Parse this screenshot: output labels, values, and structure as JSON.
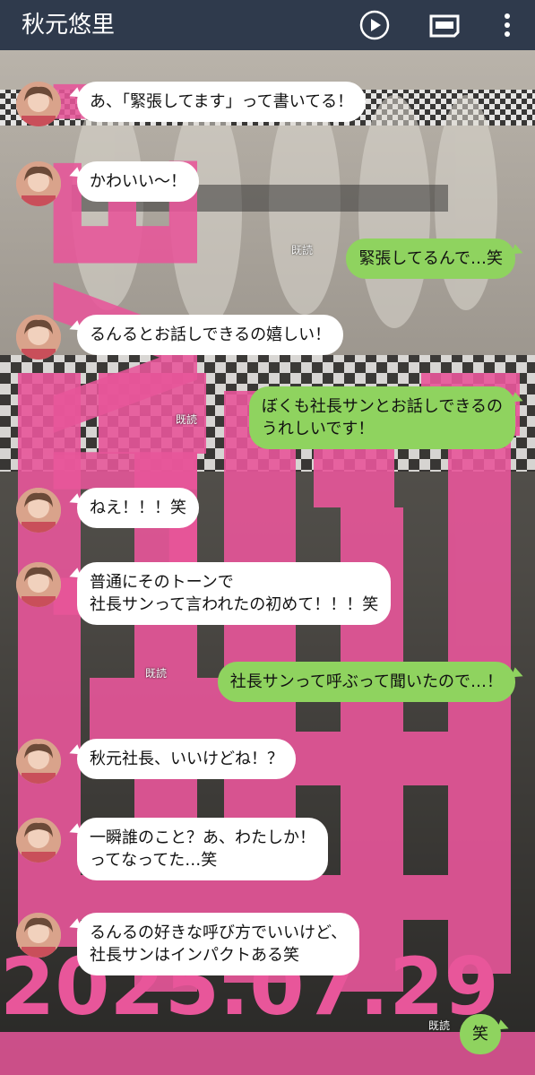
{
  "header": {
    "title": "秋元悠里",
    "play_icon": "play-circle-icon",
    "note_icon": "keep-memo-icon",
    "more_icon": "more-vertical-icon"
  },
  "background": {
    "poster_text_live": "LIVE!",
    "poster_date": "2025.07.29",
    "poster_accent": "#e8569a"
  },
  "read_label": "既読",
  "messages": [
    {
      "side": "in",
      "text": "あ、「緊張してます」って書いてる！"
    },
    {
      "side": "in",
      "text": "かわいい〜！"
    },
    {
      "side": "out",
      "text": "緊張してるんで…笑",
      "read": "既読"
    },
    {
      "side": "in",
      "text": "るんるとお話しできるの嬉しい！"
    },
    {
      "side": "out",
      "text": "ぼくも社長サンとお話しできるの\nうれしいです！",
      "read": "既読"
    },
    {
      "side": "in",
      "text": "ねえ！！！笑"
    },
    {
      "side": "in",
      "text": "普通にそのトーンで\n社長サンって言われたの初めて！！！笑"
    },
    {
      "side": "out",
      "text": "社長サンって呼ぶって聞いたので…！",
      "read": "既読"
    },
    {
      "side": "in",
      "text": "秋元社長、いいけどね！？"
    },
    {
      "side": "in",
      "text": "一瞬誰のこと？あ、わたしか！\nってなってた…笑"
    },
    {
      "side": "in",
      "text": "るんるの好きな呼び方でいいけど、\n社長サンはインパクトある笑"
    },
    {
      "side": "out",
      "text": "笑",
      "read": "既読"
    }
  ],
  "colors": {
    "header_bg": "#2f3a4c",
    "incoming_bubble": "#ffffff",
    "outgoing_bubble": "#8fd35f"
  }
}
